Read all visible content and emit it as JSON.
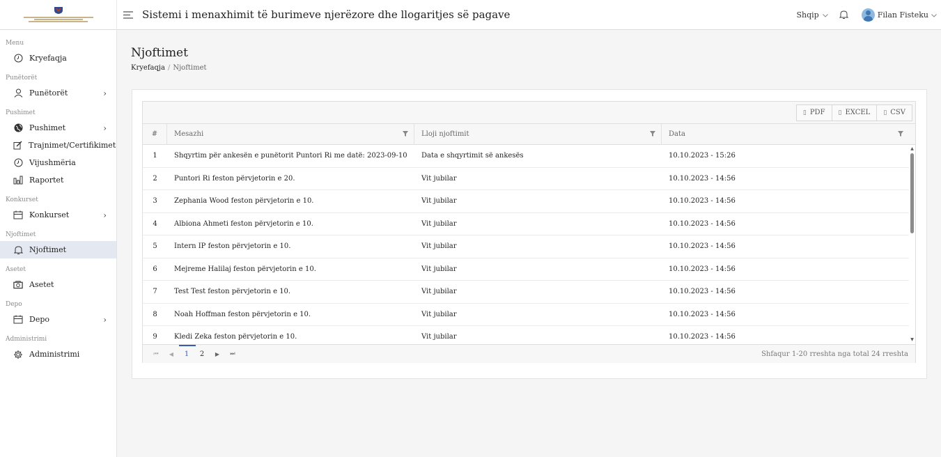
{
  "header": {
    "title": "Sistemi i menaxhimit të burimeve njerëzore dhe llogaritjes së pagave",
    "language": "Shqip",
    "user_name": "Filan Fisteku"
  },
  "sidebar": {
    "sections": [
      {
        "label": "Menu",
        "items": [
          {
            "label": "Kryefaqja",
            "icon": "clock-icon",
            "arrow": false
          }
        ]
      },
      {
        "label": "Punëtorët",
        "items": [
          {
            "label": "Punëtorët",
            "icon": "user-icon",
            "arrow": true
          }
        ]
      },
      {
        "label": "Pushimet",
        "items": [
          {
            "label": "Pushimet",
            "icon": "globe-icon",
            "arrow": true
          },
          {
            "label": "Trajnimet/Certifikimet",
            "icon": "edit-icon",
            "arrow": false
          },
          {
            "label": "Vijushmëria",
            "icon": "clock-icon",
            "arrow": false
          },
          {
            "label": "Raportet",
            "icon": "bar-chart-icon",
            "arrow": false
          }
        ]
      },
      {
        "label": "Konkurset",
        "items": [
          {
            "label": "Konkurset",
            "icon": "calendar-icon",
            "arrow": true
          }
        ]
      },
      {
        "label": "Njoftimet",
        "items": [
          {
            "label": "Njoftimet",
            "icon": "bell-icon",
            "arrow": false,
            "active": true
          }
        ]
      },
      {
        "label": "Asetet",
        "items": [
          {
            "label": "Asetet",
            "icon": "camera-icon",
            "arrow": false
          }
        ]
      },
      {
        "label": "Depo",
        "items": [
          {
            "label": "Depo",
            "icon": "calendar-icon",
            "arrow": true
          }
        ]
      },
      {
        "label": "Administrimi",
        "items": [
          {
            "label": "Administrimi",
            "icon": "gear-icon",
            "arrow": false
          }
        ]
      }
    ]
  },
  "page": {
    "title": "Njoftimet",
    "breadcrumb_home": "Kryefaqja",
    "breadcrumb_sep": "/",
    "breadcrumb_current": "Njoftimet"
  },
  "toolbar": {
    "pdf": "PDF",
    "excel": "EXCEL",
    "csv": "CSV"
  },
  "table": {
    "columns": [
      "#",
      "Mesazhi",
      "Lloji njoftimit",
      "Data"
    ],
    "rows": [
      [
        "1",
        "Shqyrtim për ankesën e punëtorit Puntori Ri me datë: 2023-09-10",
        "Data e shqyrtimit së ankesës",
        "10.10.2023 - 15:26"
      ],
      [
        "2",
        "Puntori Ri feston përvjetorin e 20.",
        "Vit jubilar",
        "10.10.2023 - 14:56"
      ],
      [
        "3",
        "Zephania Wood feston përvjetorin e 10.",
        "Vit jubilar",
        "10.10.2023 - 14:56"
      ],
      [
        "4",
        "Albiona Ahmeti feston përvjetorin e 10.",
        "Vit jubilar",
        "10.10.2023 - 14:56"
      ],
      [
        "5",
        "Intern IP feston përvjetorin e 10.",
        "Vit jubilar",
        "10.10.2023 - 14:56"
      ],
      [
        "6",
        "Mejreme Halilaj feston përvjetorin e 10.",
        "Vit jubilar",
        "10.10.2023 - 14:56"
      ],
      [
        "7",
        "Test Test feston përvjetorin e 10.",
        "Vit jubilar",
        "10.10.2023 - 14:56"
      ],
      [
        "8",
        "Noah Hoffman feston përvjetorin e 10.",
        "Vit jubilar",
        "10.10.2023 - 14:56"
      ],
      [
        "9",
        "Kledi Zeka feston përvjetorin e 10.",
        "Vit jubilar",
        "10.10.2023 - 14:56"
      ]
    ]
  },
  "pager": {
    "pages": [
      "1",
      "2"
    ],
    "current": "1",
    "info": "Shfaqur 1-20 rreshta nga total 24 rreshta"
  }
}
